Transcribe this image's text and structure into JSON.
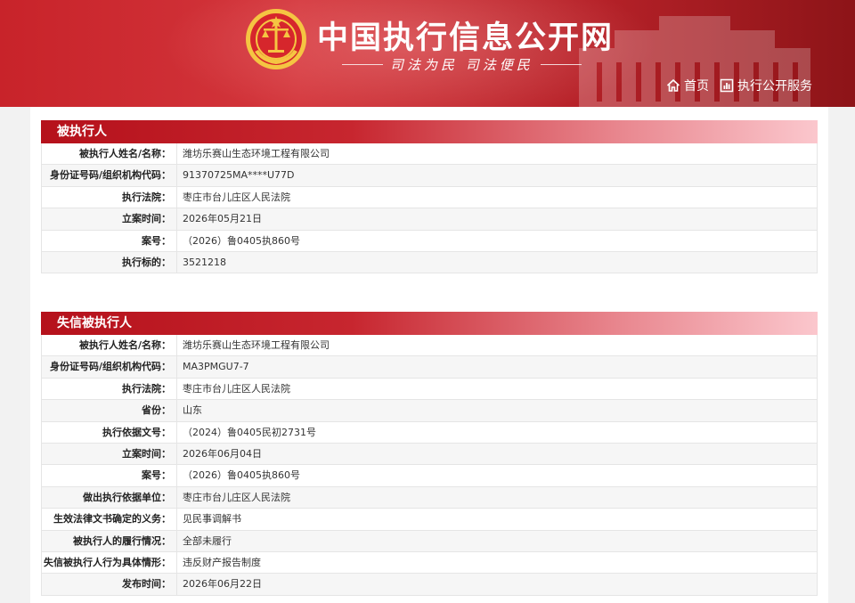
{
  "header": {
    "site_title": "中国执行信息公开网",
    "slogan": "司法为民  司法便民",
    "nav": [
      {
        "label": "首页",
        "icon": "home-icon"
      },
      {
        "label": "执行公开服务",
        "icon": "chart-icon"
      }
    ],
    "colors": {
      "header_red": "#c8232a",
      "section_red": "#b5111b"
    }
  },
  "executee": {
    "title": "被执行人",
    "rows": [
      {
        "label": "被执行人姓名/名称：",
        "value": "潍坊乐赛山生态环境工程有限公司"
      },
      {
        "label": "身份证号码/组织机构代码：",
        "value": "91370725MA****U77D"
      },
      {
        "label": "执行法院：",
        "value": "枣庄市台儿庄区人民法院"
      },
      {
        "label": "立案时间：",
        "value": "2026年05月21日"
      },
      {
        "label": "案号：",
        "value": "（2026）鲁0405执860号"
      },
      {
        "label": "执行标的：",
        "value": "3521218"
      }
    ]
  },
  "dishonest": {
    "title": "失信被执行人",
    "rows": [
      {
        "label": "被执行人姓名/名称：",
        "value": "潍坊乐赛山生态环境工程有限公司"
      },
      {
        "label": "身份证号码/组织机构代码：",
        "value": "MA3PMGU7-7"
      },
      {
        "label": "执行法院：",
        "value": "枣庄市台儿庄区人民法院"
      },
      {
        "label": "省份：",
        "value": "山东"
      },
      {
        "label": "执行依据文号：",
        "value": "（2024）鲁0405民初2731号"
      },
      {
        "label": "立案时间：",
        "value": "2026年06月04日"
      },
      {
        "label": "案号：",
        "value": "（2026）鲁0405执860号"
      },
      {
        "label": "做出执行依据单位：",
        "value": "枣庄市台儿庄区人民法院"
      },
      {
        "label": "生效法律文书确定的义务：",
        "value": "见民事调解书"
      },
      {
        "label": "被执行人的履行情况：",
        "value": "全部未履行"
      },
      {
        "label": "失信被执行人行为具体情形：",
        "value": "违反财产报告制度"
      },
      {
        "label": "发布时间：",
        "value": "2026年06月22日"
      }
    ]
  }
}
